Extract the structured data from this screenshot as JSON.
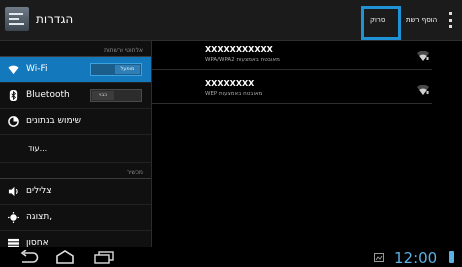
{
  "app_bar": {
    "title": "הגדרות",
    "scan_label": "סרוק",
    "add_network_label": "הוסף רשת"
  },
  "sidebar": {
    "section_wireless": "אלחוטי ורשתות",
    "wifi": {
      "label": "Wi-Fi",
      "toggle": "מופעל",
      "on": true
    },
    "bluetooth": {
      "label": "Bluetooth",
      "toggle": "כבוי",
      "on": false
    },
    "data_usage": "שימוש בנתונים",
    "more": "עוד...",
    "section_device": "מכשיר",
    "sound": "צלילים",
    "display": "תצוגה,",
    "storage": "אחסון"
  },
  "networks": [
    {
      "ssid": "XXXXXXXXXXX",
      "security": "WPA/WPA2 מאובטח באמצעות"
    },
    {
      "ssid": "XXXXXXXX",
      "security": "WEP מאובטח באמצעות"
    }
  ],
  "status_bar": {
    "time": "12:00"
  },
  "colors": {
    "accent": "#1478bd",
    "highlight": "#1f93d6",
    "clock": "#5ab1e6"
  },
  "icons": [
    "settings-app-icon",
    "overflow-menu-icon",
    "wifi-icon",
    "bluetooth-icon",
    "data-usage-icon",
    "sound-icon",
    "display-icon",
    "storage-icon",
    "wifi-signal-icon",
    "back-icon",
    "home-icon",
    "recent-apps-icon",
    "screenshot-icon",
    "battery-icon"
  ]
}
